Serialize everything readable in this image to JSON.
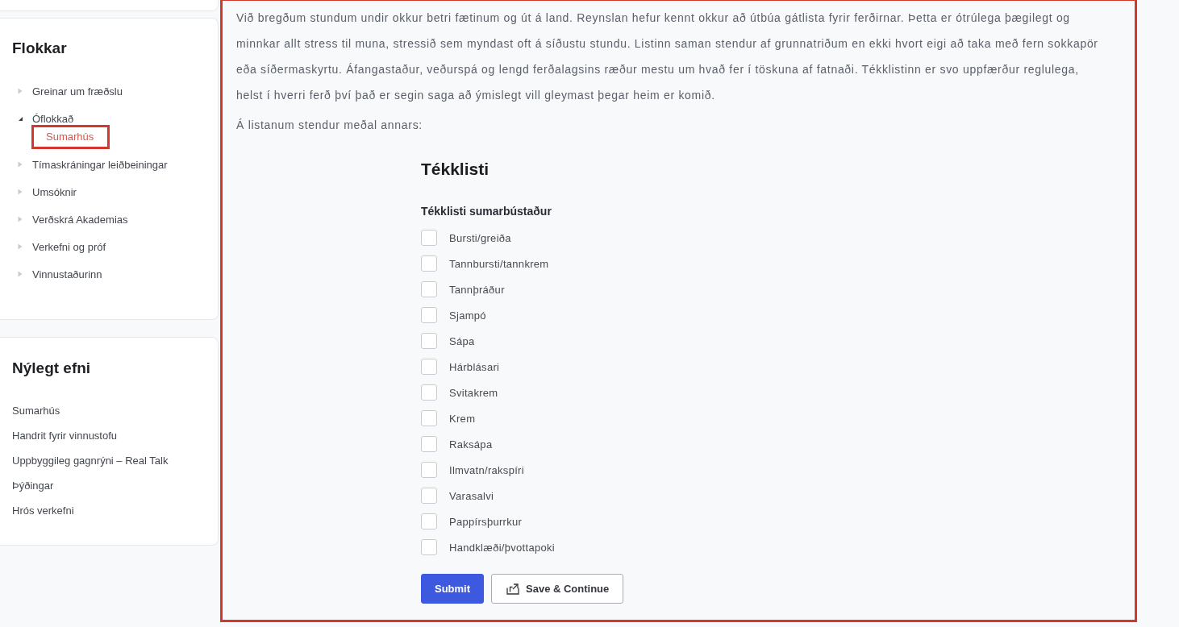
{
  "sidebar": {
    "categories": {
      "title": "Flokkar",
      "items": [
        {
          "label": "Greinar um fræðslu",
          "expanded": false,
          "selected": false
        },
        {
          "label": "Óflokkað",
          "expanded": true,
          "selected": false,
          "children": [
            {
              "label": "Sumarhús",
              "selected": true,
              "highlighted": true
            }
          ]
        },
        {
          "label": "Tímaskráningar leiðbeiningar",
          "expanded": false,
          "selected": false
        },
        {
          "label": "Umsóknir",
          "expanded": false,
          "selected": false
        },
        {
          "label": "Verðskrá Akademias",
          "expanded": false,
          "selected": false
        },
        {
          "label": "Verkefni og próf",
          "expanded": false,
          "selected": false
        },
        {
          "label": "Vinnustaðurinn",
          "expanded": false,
          "selected": false
        }
      ]
    },
    "recent": {
      "title": "Nýlegt efni",
      "items": [
        "Sumarhús",
        "Handrit fyrir vinnustofu",
        "Uppbyggileg gagnrýni – Real Talk",
        "Þýðingar",
        "Hrós verkefni"
      ]
    }
  },
  "content": {
    "highlighted": true,
    "paragraphs": [
      "Við bregðum stundum undir okkur betri fætinum og út á land. Reynslan hefur kennt okkur að útbúa gátlista fyrir ferðirnar. Þetta er ótrúlega þægilegt og minnkar allt stress til muna, stressið sem myndast oft á síðustu stundu. Listinn saman stendur af grunnatriðum en ekki hvort eigi að taka með fern sokkapör eða síðermaskyrtu. Áfangastaður, veðurspá og lengd ferðalagsins ræður mestu um hvað fer í töskuna af fatnaði. Tékklistinn er svo uppfærður reglulega, helst í hverri ferð því það er segin saga að ýmislegt vill gleymast þegar heim er komið.",
      "Á listanum stendur meðal annars:"
    ],
    "form": {
      "title": "Tékklisti",
      "group_label": "Tékklisti sumarbústaður",
      "items": [
        {
          "label": "Bursti/greiða",
          "checked": false
        },
        {
          "label": "Tannbursti/tannkrem",
          "checked": false
        },
        {
          "label": "Tannþráður",
          "checked": false
        },
        {
          "label": "Sjampó",
          "checked": false
        },
        {
          "label": "Sápa",
          "checked": false
        },
        {
          "label": "Hárblásari",
          "checked": false
        },
        {
          "label": "Svitakrem",
          "checked": false
        },
        {
          "label": "Krem",
          "checked": false
        },
        {
          "label": "Raksápa",
          "checked": false
        },
        {
          "label": "Ilmvatn/rakspíri",
          "checked": false
        },
        {
          "label": "Varasalvi",
          "checked": false
        },
        {
          "label": "Pappírsþurrkur",
          "checked": false
        },
        {
          "label": "Handklæði/þvottapoki",
          "checked": false
        }
      ],
      "buttons": [
        {
          "kind": "primary",
          "label": "Submit"
        },
        {
          "kind": "secondary",
          "label": "Save & Continue"
        }
      ]
    }
  }
}
